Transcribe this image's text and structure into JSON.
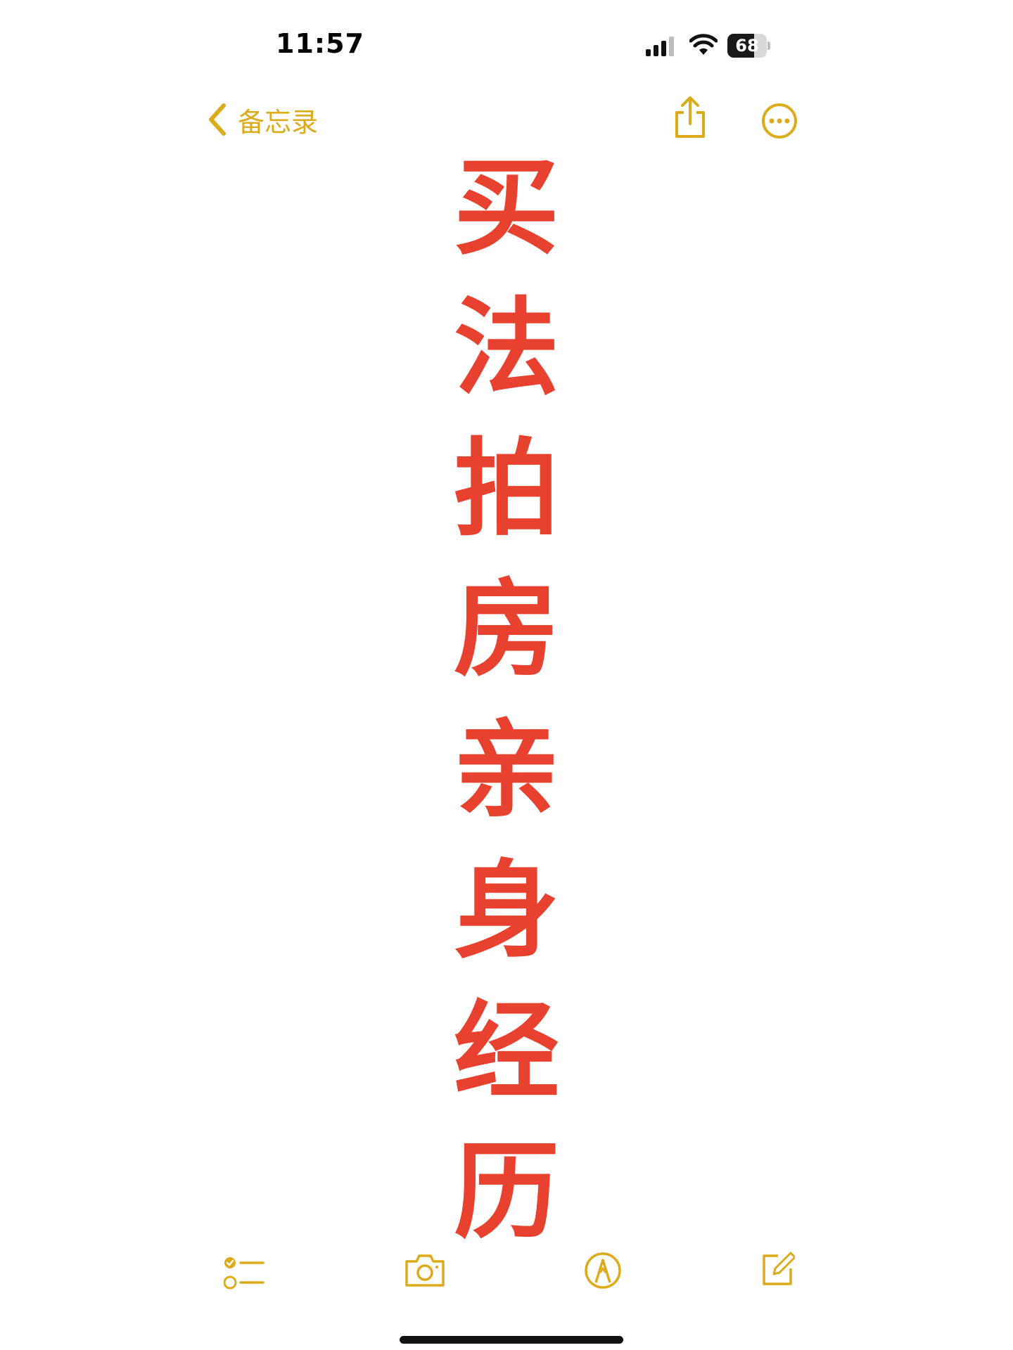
{
  "status_bar": {
    "time": "11:57",
    "battery_level": "68",
    "battery_fraction": 0.68,
    "signal_icon": "cellular-signal-icon",
    "wifi_icon": "wifi-icon"
  },
  "nav": {
    "back_label": "备忘录",
    "back_icon": "chevron-left-icon",
    "share_icon": "share-icon",
    "more_icon": "ellipsis-circle-icon",
    "accent_color": "#dcab1b"
  },
  "note": {
    "text_color": "#e8412f",
    "characters": [
      "买",
      "法",
      "拍",
      "房",
      "亲",
      "身",
      "经",
      "历"
    ]
  },
  "toolbar": {
    "checklist_icon": "checklist-icon",
    "camera_icon": "camera-icon",
    "markup_icon": "markup-pen-icon",
    "compose_icon": "compose-icon"
  }
}
